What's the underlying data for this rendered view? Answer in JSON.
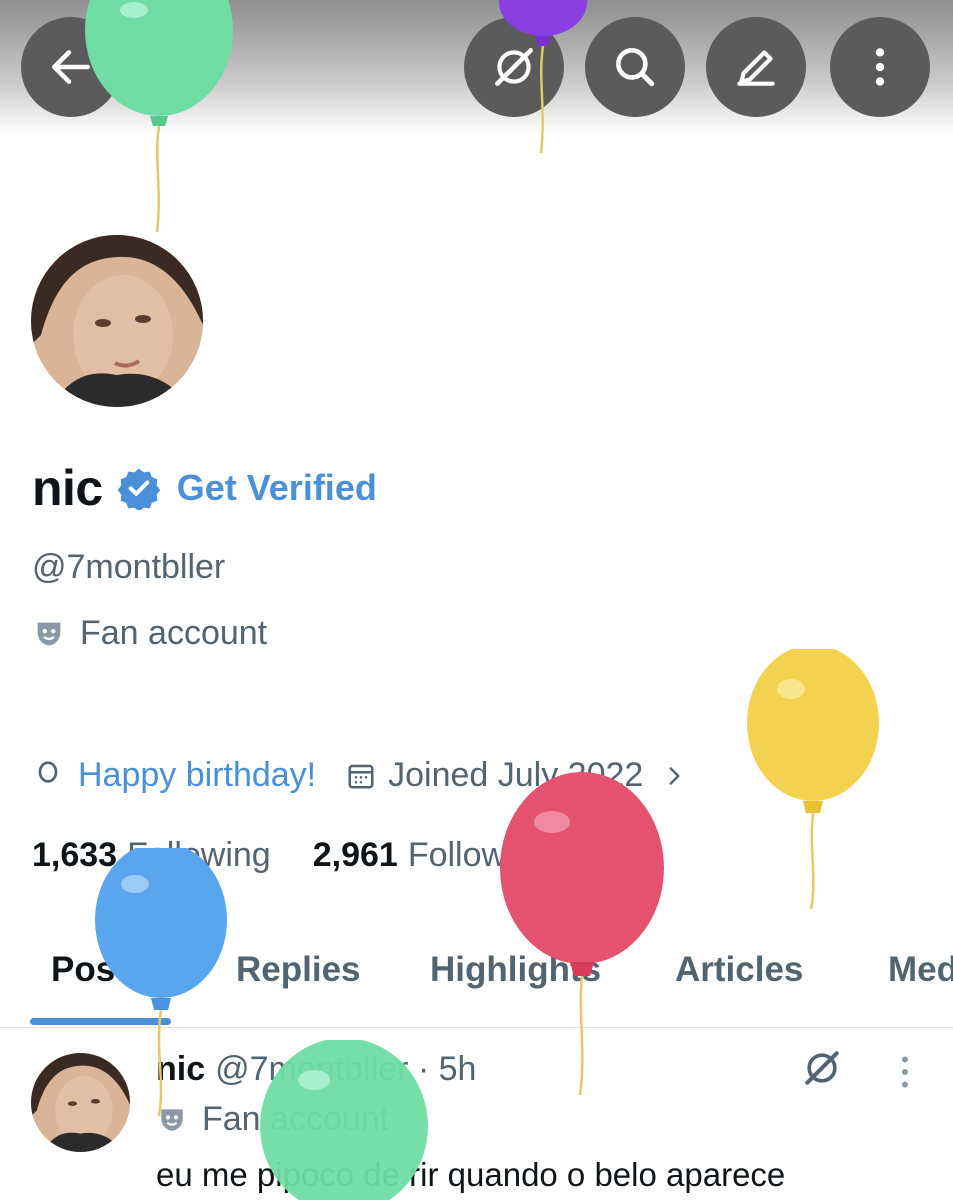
{
  "profile": {
    "display_name": "nic",
    "get_verified": "Get Verified",
    "handle": "@7montbller",
    "fan_label": "Fan account",
    "birthday": "Happy birthday!",
    "joined": "Joined July 2022"
  },
  "stats": {
    "following_count": "1,633",
    "following_label": "Following",
    "followers_count": "2,961",
    "followers_label": "Followers"
  },
  "tabs": [
    {
      "label": "Posts"
    },
    {
      "label": "Replies"
    },
    {
      "label": "Highlights"
    },
    {
      "label": "Articles"
    },
    {
      "label": "Media"
    }
  ],
  "post": {
    "name": "nic",
    "meta": "@7montbller · 5h",
    "fan_label": "Fan account",
    "text": "eu me pipoco de rir quando o belo aparece"
  },
  "colors": {
    "accent": "#4a90d9",
    "button_bg": "#5b5b5b",
    "muted_text": "#536471"
  }
}
